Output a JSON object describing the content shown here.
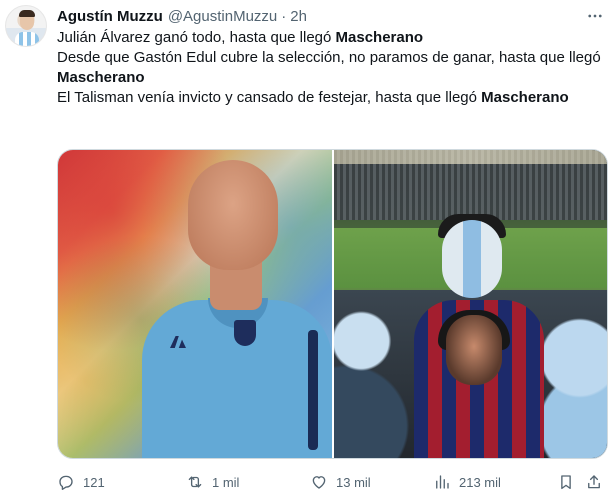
{
  "author": {
    "name": "Agustín Muzzu",
    "handle": "@AgustinMuzzu",
    "separator": "·",
    "time": "2h"
  },
  "tweet": {
    "lines": [
      {
        "before": "Julián Álvarez ganó todo, hasta que llegó ",
        "bold": "Mascherano"
      },
      {
        "before": "Desde que Gastón Edul cubre la selección, no paramos de ganar, hasta que llegó ",
        "bold": "Mascherano"
      },
      {
        "before": "El Talisman venía invicto y cansado de festejar, hasta que llegó ",
        "bold": "Mascherano"
      }
    ]
  },
  "media": {
    "count": 2
  },
  "actions": {
    "reply_count": "121",
    "retweet_count": "1 mil",
    "like_count": "13 mil",
    "views_count": "213 mil"
  },
  "icons": {
    "reply": "reply-icon",
    "retweet": "retweet-icon",
    "like": "heart-icon",
    "views": "views-icon",
    "bookmark": "bookmark-icon",
    "share": "share-icon",
    "more": "more-icon"
  },
  "colors": {
    "text": "#0f1419",
    "secondary": "#536471",
    "border": "#cfd9de"
  }
}
